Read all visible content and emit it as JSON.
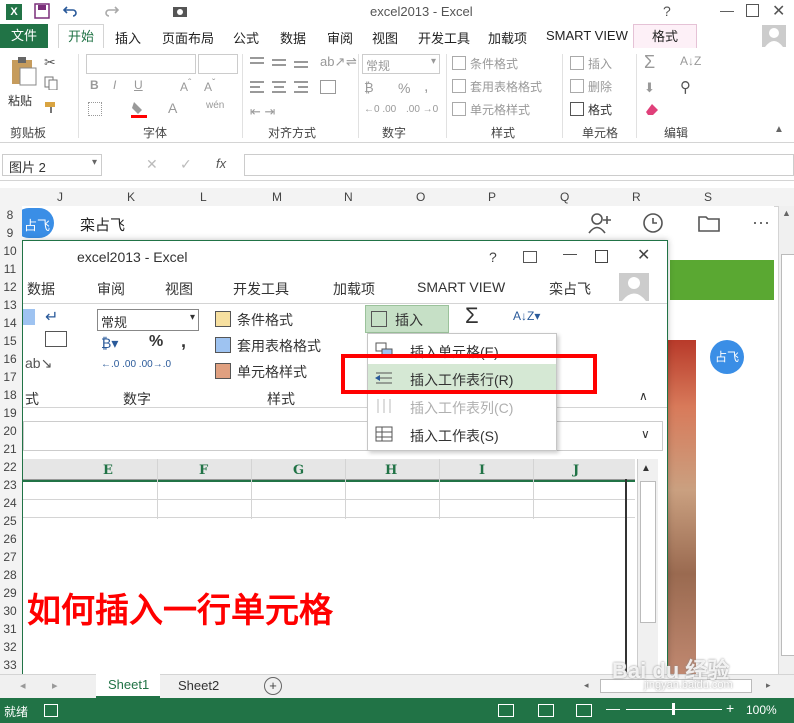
{
  "window": {
    "title": "excel2013 - Excel"
  },
  "ribbon_tabs": [
    "文件",
    "开始",
    "插入",
    "页面布局",
    "公式",
    "数据",
    "审阅",
    "视图",
    "开发工具",
    "加载项",
    "SMART VIEW",
    "格式"
  ],
  "ribbon": {
    "paste": "粘贴",
    "number_format": "常规",
    "cond_format": "条件格式",
    "table_format": "套用表格格式",
    "cell_style": "单元格样式",
    "insert": "插入",
    "delete": "删除",
    "format": "格式",
    "groups": [
      "剪贴板",
      "字体",
      "对齐方式",
      "数字",
      "样式",
      "单元格",
      "编辑"
    ]
  },
  "formula_bar": {
    "name_box": "图片 2",
    "fx": "fx"
  },
  "columns": [
    "J",
    "K",
    "L",
    "M",
    "N",
    "O",
    "P",
    "Q",
    "R",
    "S"
  ],
  "rows": [
    "8",
    "9",
    "10",
    "11",
    "12",
    "13",
    "14",
    "15",
    "16",
    "17",
    "18",
    "19",
    "20",
    "21",
    "22",
    "23",
    "24",
    "25",
    "26",
    "27",
    "28",
    "29",
    "30",
    "31",
    "32",
    "33"
  ],
  "chat": {
    "avatar_left": "占飞",
    "name": "栾占飞",
    "avatar_right": "占飞"
  },
  "inner": {
    "title": "excel2013 - Excel",
    "help": "?",
    "tabs": [
      "数据",
      "审阅",
      "视图",
      "开发工具",
      "加载项",
      "SMART VIEW"
    ],
    "user": "栾占飞",
    "number_format": "常规",
    "percent": "%",
    "comma": ",",
    "cond_format": "条件格式",
    "table_format": "套用表格格式",
    "cell_style": "单元格样式",
    "insert": "插入",
    "sigma": "Σ",
    "groups": [
      "式",
      "数字",
      "样式"
    ],
    "columns": [
      "E",
      "F",
      "G",
      "H",
      "I",
      "J"
    ],
    "menu": [
      {
        "label": "插入单元格(E)",
        "enabled": true
      },
      {
        "label": "插入工作表行(R)",
        "enabled": true,
        "hover": true
      },
      {
        "label": "插入工作表列(C)",
        "enabled": false
      },
      {
        "label": "插入工作表(S)",
        "enabled": true
      }
    ],
    "big_text": "如何插入一行单元格"
  },
  "sheets": [
    "Sheet1",
    "Sheet2"
  ],
  "status": {
    "ready": "就绪",
    "zoom": "100%"
  },
  "watermark": {
    "text": "Bai du 经验",
    "sub": "jingyan.baidu.com"
  },
  "colors": {
    "excel_green": "#217346",
    "highlight": "#ff0000",
    "menu_hover": "#d5e8d4"
  }
}
